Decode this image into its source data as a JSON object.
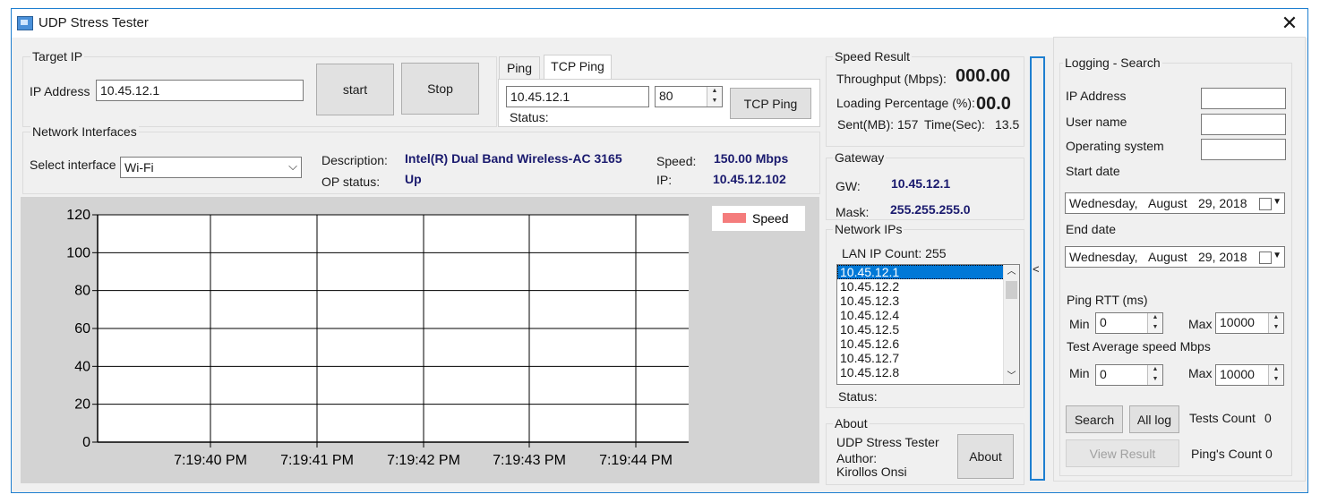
{
  "window": {
    "title": "UDP Stress Tester",
    "close_glyph": "✕"
  },
  "target_ip": {
    "group_label": "Target IP",
    "ip_label": "IP Address",
    "ip_value": "10.45.12.1",
    "start_label": "start",
    "stop_label": "Stop"
  },
  "ping": {
    "tabs": [
      "Ping",
      "TCP Ping"
    ],
    "active_tab": "TCP Ping",
    "host_value": "10.45.12.1",
    "port_value": "80",
    "status_label": "Status:",
    "button_label": "TCP Ping"
  },
  "speed_result": {
    "group_label": "Speed Result",
    "throughput_label": "Throughput (Mbps):",
    "throughput_value": "000.00",
    "loading_label": "Loading Percentage (%):",
    "loading_value": "00.0",
    "sent_label": "Sent(MB):",
    "sent_value": "157",
    "time_label": "Time(Sec):",
    "time_value": "13.5"
  },
  "network_interfaces": {
    "group_label": "Network Interfaces",
    "select_label": "Select interface",
    "selected": "Wi-Fi",
    "description_label": "Description:",
    "description_value": "Intel(R) Dual Band Wireless-AC 3165",
    "op_status_label": "OP status:",
    "op_status_value": "Up",
    "speed_label": "Speed:",
    "speed_value": "150.00 Mbps",
    "ip_label": "IP:",
    "ip_value": "10.45.12.102"
  },
  "gateway": {
    "group_label": "Gateway",
    "gw_label": "GW:",
    "gw_value": "10.45.12.1",
    "mask_label": "Mask:",
    "mask_value": "255.255.255.0"
  },
  "network_ips": {
    "group_label": "Network IPs",
    "count_label": "LAN IP Count: 255",
    "items": [
      "10.45.12.1",
      "10.45.12.2",
      "10.45.12.3",
      "10.45.12.4",
      "10.45.12.5",
      "10.45.12.6",
      "10.45.12.7",
      "10.45.12.8"
    ],
    "selected_index": 0,
    "status_label": "Status:"
  },
  "about": {
    "group_label": "About",
    "line1": "UDP Stress Tester",
    "line2": "Author:",
    "line3": "Kirollos Onsi",
    "button_label": "About"
  },
  "collapse_toggle": {
    "glyph": "<"
  },
  "logging": {
    "group_label": "Logging - Search",
    "ip_label": "IP Address",
    "user_label": "User name",
    "os_label": "Operating system",
    "start_date_label": "Start date",
    "start_date": {
      "weekday": "Wednesday,",
      "month": "August",
      "day_year": "29, 2018"
    },
    "end_date_label": "End date",
    "end_date": {
      "weekday": "Wednesday,",
      "month": "August",
      "day_year": "29, 2018"
    },
    "ping_rtt_label": "Ping RTT (ms)",
    "min_label": "Min",
    "max_label": "Max",
    "ping_min": "0",
    "ping_max": "10000",
    "avg_speed_label": "Test Average speed Mbps",
    "speed_min": "0",
    "speed_max": "10000",
    "search_label": "Search",
    "all_log_label": "All log",
    "tests_count_label": "Tests Count",
    "tests_count_value": "0",
    "view_result_label": "View Result",
    "pings_count_label": "Ping's Count",
    "pings_count_value": "0"
  },
  "chart_data": {
    "type": "line",
    "title": "",
    "xlabel": "",
    "ylabel": "",
    "ylim": [
      0,
      120
    ],
    "y_ticks": [
      "120",
      "100",
      "80",
      "60",
      "40",
      "20",
      "0"
    ],
    "x_ticks": [
      "7:19:40 PM",
      "7:19:41 PM",
      "7:19:42 PM",
      "7:19:43 PM",
      "7:19:44 PM"
    ],
    "series": [
      {
        "name": "Speed",
        "color": "#f47c7c",
        "values": []
      }
    ],
    "legend": "top-right",
    "grid": true
  },
  "colors": {
    "accent": "#1e7fd0",
    "value_text": "#1a1a6e",
    "chart_bg": "#d3d3d3",
    "legend_swatch": "#f47c7c"
  }
}
